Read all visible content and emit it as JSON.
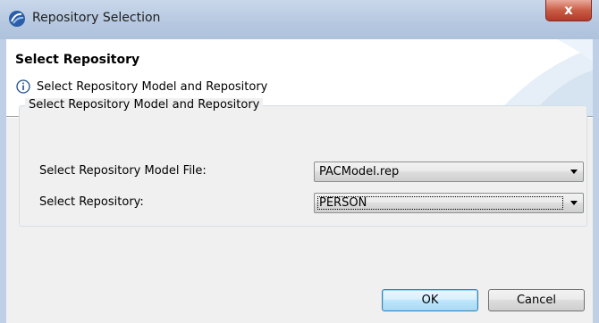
{
  "window": {
    "title": "Repository Selection",
    "close_glyph": "x"
  },
  "header": {
    "title": "Select Repository",
    "message": "Select Repository Model and Repository",
    "icon": "info-icon"
  },
  "group": {
    "legend": "Select Repository Model and Repository",
    "model_file_label": "Select Repository Model File:",
    "model_file_value": "PACModel.rep",
    "repository_label": "Select Repository:",
    "repository_value": "PERSON"
  },
  "buttons": {
    "ok": "OK",
    "cancel": "Cancel"
  },
  "colors": {
    "titlebar": "#b6c8e0",
    "close_button": "#c95d45",
    "default_button_border": "#3c7fb1"
  }
}
